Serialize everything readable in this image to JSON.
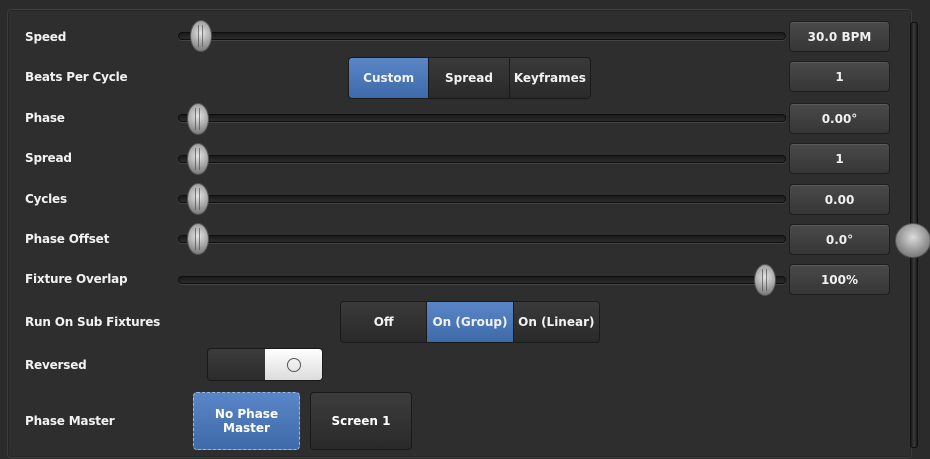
{
  "rows": {
    "speed": {
      "label": "Speed",
      "value": "30.0 BPM",
      "level": 0.0
    },
    "beats_per_cycle": {
      "label": "Beats Per Cycle",
      "value": "1",
      "options": [
        "Custom",
        "Spread",
        "Keyframes"
      ],
      "selected": "Custom"
    },
    "phase": {
      "label": "Phase",
      "value": "0.00°",
      "level": 0.0
    },
    "spread": {
      "label": "Spread",
      "value": "1",
      "level": 0.0
    },
    "cycles": {
      "label": "Cycles",
      "value": "0.00",
      "level": 0.0
    },
    "phase_offset": {
      "label": "Phase Offset",
      "value": "0.0°",
      "level": 0.0
    },
    "fixture_overlap": {
      "label": "Fixture Overlap",
      "value": "100%",
      "level": 1.0
    },
    "run_on_sub": {
      "label": "Run On Sub Fixtures",
      "options": [
        "Off",
        "On (Group)",
        "On (Linear)"
      ],
      "selected": "On (Group)"
    },
    "reversed": {
      "label": "Reversed",
      "state": "off"
    },
    "phase_master": {
      "label": "Phase Master",
      "options": [
        "No Phase Master",
        "Screen 1"
      ],
      "selected": "No Phase Master"
    }
  },
  "colors": {
    "accent": "#4a78bd",
    "panel": "#2e2e2e"
  },
  "icons": {
    "toggle": "circle-icon",
    "slider": "slider-thumb",
    "scroll": "scrollbar-thumb"
  }
}
